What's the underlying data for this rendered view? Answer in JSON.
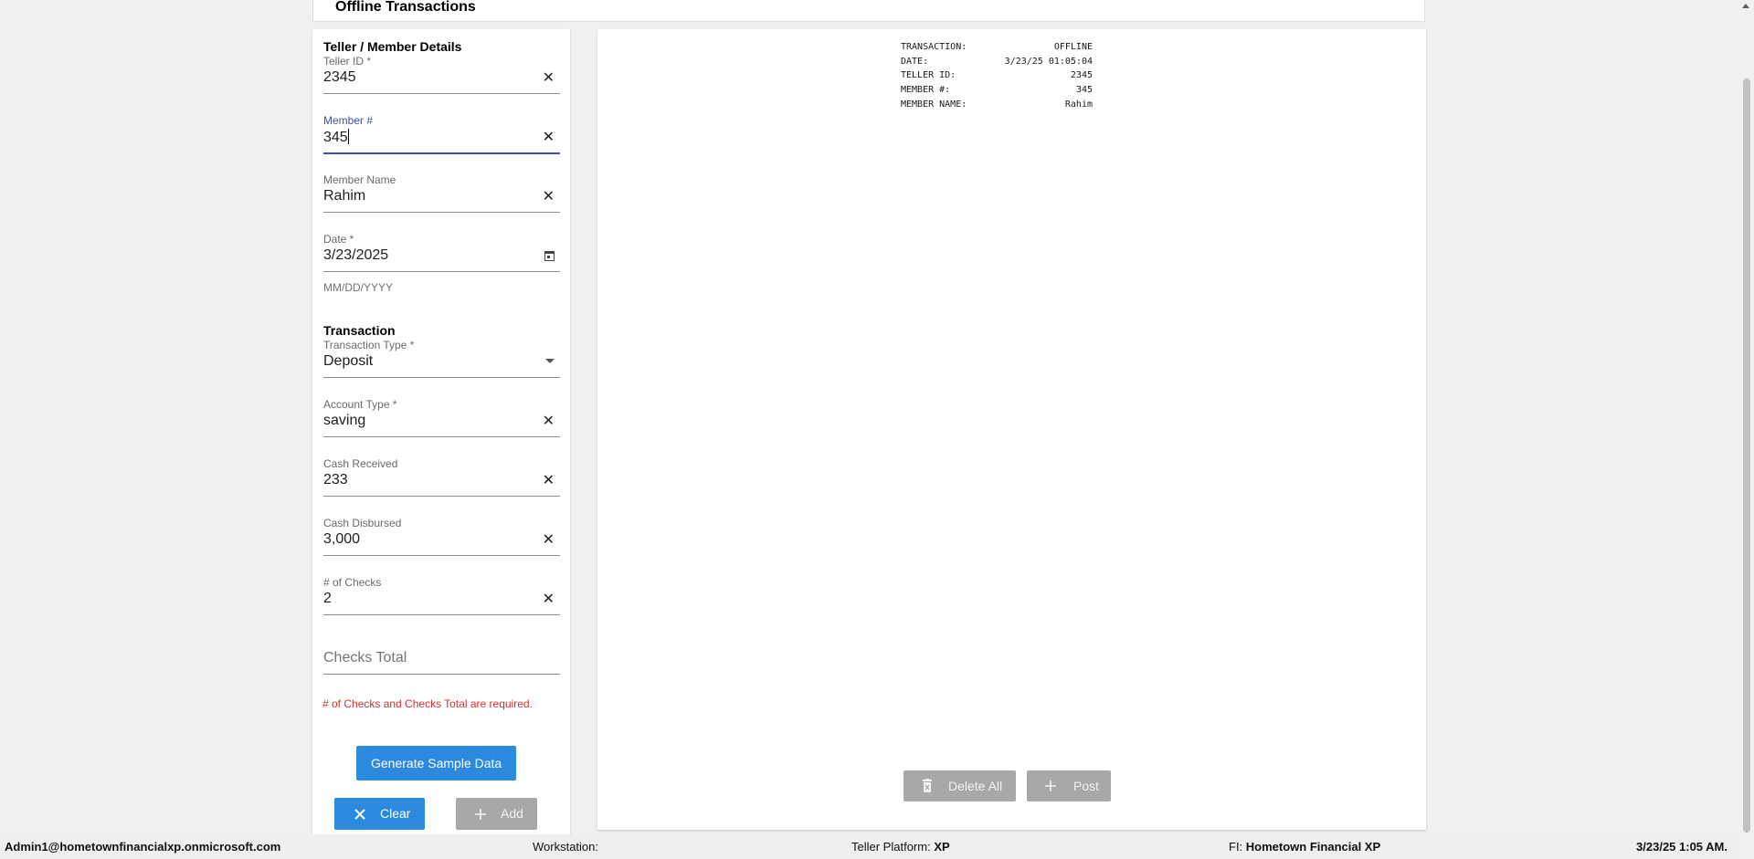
{
  "header": {
    "title": "Offline Transactions"
  },
  "details": {
    "section_title": "Teller / Member Details",
    "teller_id": {
      "label": "Teller ID *",
      "value": "2345"
    },
    "member_no": {
      "label": "Member #",
      "value": "345"
    },
    "member_name": {
      "label": "Member Name",
      "value": "Rahim"
    },
    "date": {
      "label": "Date *",
      "value": "3/23/2025",
      "hint": "MM/DD/YYYY"
    }
  },
  "transaction": {
    "section_title": "Transaction",
    "type": {
      "label": "Transaction Type *",
      "value": "Deposit"
    },
    "account_type": {
      "label": "Account Type *",
      "value": "saving"
    },
    "cash_received": {
      "label": "Cash Received",
      "value": "233"
    },
    "cash_disbursed": {
      "label": "Cash Disbursed",
      "value": "3,000"
    },
    "checks_count": {
      "label": "# of Checks",
      "value": "2"
    },
    "checks_total": {
      "placeholder": "Checks Total"
    },
    "error": "# of Checks and Checks Total are required."
  },
  "buttons": {
    "generate": "Generate Sample Data",
    "clear": "Clear",
    "add": "Add",
    "delete_all": "Delete All",
    "post": "Post"
  },
  "receipt": [
    {
      "key": "TRANSACTION:",
      "value": "OFFLINE"
    },
    {
      "key": "DATE:",
      "value": "3/23/25 01:05:04"
    },
    {
      "key": "TELLER ID:",
      "value": "2345"
    },
    {
      "key": "MEMBER #:",
      "value": "345"
    },
    {
      "key": "MEMBER NAME:",
      "value": "Rahim"
    }
  ],
  "status": {
    "user": "Admin1@hometownfinancialxp.onmicrosoft.com",
    "workstation_label": "Workstation:",
    "workstation_value": "",
    "platform_label": "Teller Platform:",
    "platform_value": "XP",
    "fi_label": "FI:",
    "fi_value": "Hometown Financial XP",
    "datetime": "3/23/25 1:05 AM."
  },
  "colors": {
    "primary": "#2b89df",
    "focus": "#3f51b5",
    "error": "#d32f2f",
    "disabled": "#a8a8a8"
  },
  "icons": [
    "close-icon",
    "calendar-icon",
    "dropdown-arrow-icon",
    "trash-icon",
    "plus-icon"
  ]
}
